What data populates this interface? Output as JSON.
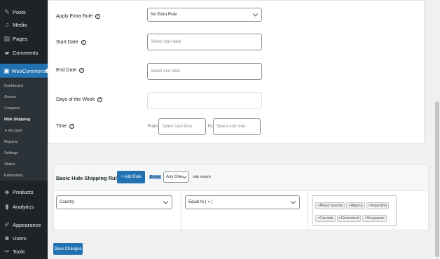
{
  "sidebar": {
    "items": [
      {
        "label": "Posts",
        "icon": "pin-icon"
      },
      {
        "label": "Media",
        "icon": "media-icon"
      },
      {
        "label": "Pages",
        "icon": "page-icon"
      },
      {
        "label": "Comments",
        "icon": "comment-icon"
      },
      {
        "label": "WooCommerce",
        "icon": "woo-icon"
      },
      {
        "label": "Products",
        "icon": "box-icon"
      },
      {
        "label": "Analytics",
        "icon": "chart-icon"
      },
      {
        "label": "Appearance",
        "icon": "brush-icon"
      },
      {
        "label": "Users",
        "icon": "user-icon"
      },
      {
        "label": "Tools",
        "icon": "wrench-icon"
      }
    ],
    "submenu": [
      "Dashboard",
      "Orders",
      "Coupons",
      "Hide Shipping",
      "↳ Account",
      "Reports",
      "Settings",
      "Status",
      "Extensions"
    ]
  },
  "form": {
    "extra_rule_label": "Apply Extra Rule",
    "extra_rule_value": "No Extra Rule",
    "start_date_label": "Start Date",
    "start_date_placeholder": "Select start date",
    "end_date_label": "End Date",
    "end_date_placeholder": "Select end date",
    "days_label": "Days of the Week",
    "time_label": "Time",
    "from_label": "From:",
    "from_placeholder": "Select start time",
    "to_label": "To:",
    "to_placeholder": "Select end time"
  },
  "rules": {
    "title": "Basic Hide Shipping Rules",
    "add_rule_label": "+ Add Rule",
    "below_label": "Below",
    "match_value": "Any One",
    "match_suffix": "rule match",
    "field_value": "Country",
    "operator_value": "Equal to ( = )",
    "tags": [
      "Åland Islands",
      "Algeria",
      "Argentina",
      "Canada",
      "Greenland",
      "Singapore"
    ]
  },
  "save_label": "Save Changes",
  "colors": {
    "sidebar": "#1d2327",
    "accent": "#2271b1"
  }
}
